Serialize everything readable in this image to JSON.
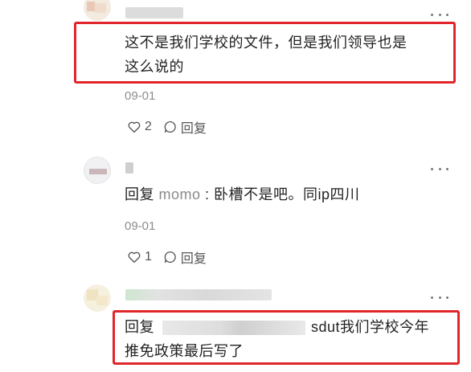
{
  "comments": [
    {
      "text_line1": "这不是我们学校的文件，但是我们领导也是",
      "text_line2": "这么说的",
      "date": "09-01",
      "like_count": "2",
      "reply_label": "回复"
    },
    {
      "reply_prefix": "回复",
      "mention": "momo",
      "separator": " : ",
      "text": "卧槽不是吧。同ip四川",
      "date": "09-01",
      "like_count": "1",
      "reply_label": "回复"
    },
    {
      "reply_prefix": "回复",
      "text_line1": "sdut我们学校今年",
      "text_line2": "推免政策最后写了"
    }
  ],
  "colors": {
    "highlight_border": "#e0262b",
    "meta_text": "#8c8c8c"
  },
  "icons": [
    "more-icon",
    "heart-icon",
    "comment-bubble-icon"
  ]
}
